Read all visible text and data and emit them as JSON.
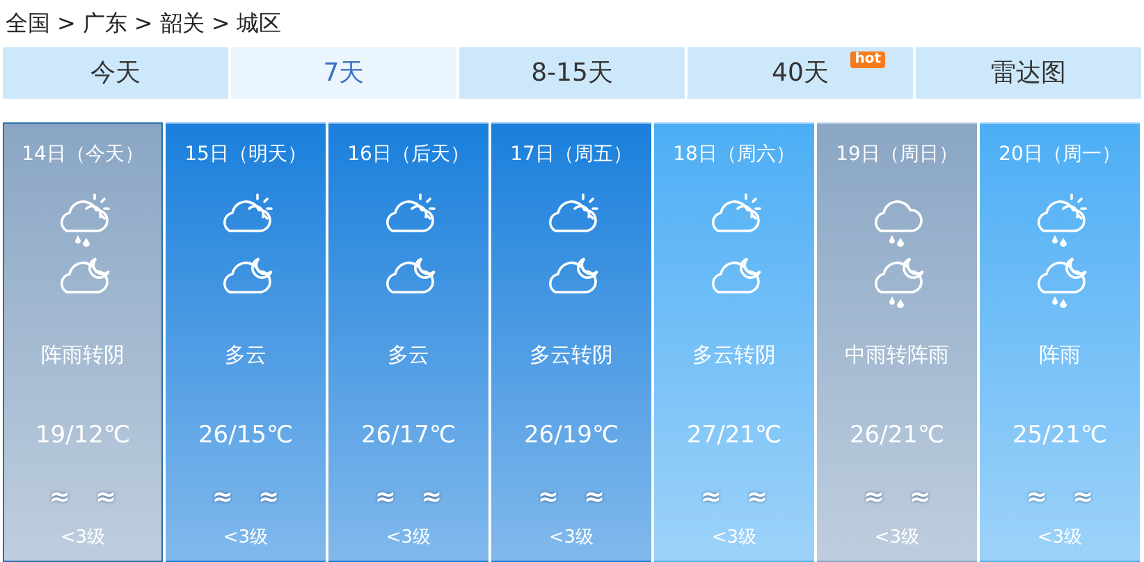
{
  "breadcrumb": [
    "全国",
    ">",
    "广东",
    ">",
    "韶关",
    ">",
    "城区"
  ],
  "tabs": [
    {
      "label": "今天",
      "selected": false
    },
    {
      "label": "7天",
      "selected": true
    },
    {
      "label": "8-15天",
      "selected": false
    },
    {
      "label": "40天",
      "selected": false,
      "badge": "hot"
    },
    {
      "label": "雷达图",
      "selected": false
    }
  ],
  "days": [
    {
      "date": "14日（今天）",
      "selected": true,
      "color": "#8aa6c4",
      "day_icon": {
        "kind": "shower"
      },
      "night_icon": {
        "kind": "cloudy-night"
      },
      "weather": "阵雨转阴",
      "temp": "19/12℃",
      "wind": [
        "≈",
        "≈"
      ],
      "level": "<3级"
    },
    {
      "date": "15日（明天）",
      "selected": false,
      "color": "#1a7fdc",
      "day_icon": {
        "kind": "partly-cloudy"
      },
      "night_icon": {
        "kind": "cloudy-night"
      },
      "weather": "多云",
      "temp": "26/15℃",
      "wind": [
        "≈",
        "≈"
      ],
      "level": "<3级"
    },
    {
      "date": "16日（后天）",
      "selected": false,
      "color": "#1a7fdc",
      "day_icon": {
        "kind": "partly-cloudy"
      },
      "night_icon": {
        "kind": "cloudy-night"
      },
      "weather": "多云",
      "temp": "26/17℃",
      "wind": [
        "≈",
        "≈"
      ],
      "level": "<3级"
    },
    {
      "date": "17日（周五）",
      "selected": false,
      "color": "#1a7fdc",
      "day_icon": {
        "kind": "partly-cloudy"
      },
      "night_icon": {
        "kind": "cloudy-night"
      },
      "weather": "多云转阴",
      "temp": "26/19℃",
      "wind": [
        "≈",
        "≈"
      ],
      "level": "<3级"
    },
    {
      "date": "18日（周六）",
      "selected": false,
      "color": "#4daef5",
      "day_icon": {
        "kind": "partly-cloudy"
      },
      "night_icon": {
        "kind": "cloudy-night"
      },
      "weather": "多云转阴",
      "temp": "27/21℃",
      "wind": [
        "≈",
        "≈"
      ],
      "level": "<3级"
    },
    {
      "date": "19日（周日）",
      "selected": false,
      "color": "#8aa6c4",
      "day_icon": {
        "kind": "rain"
      },
      "night_icon": {
        "kind": "shower-night"
      },
      "weather": "中雨转阵雨",
      "temp": "26/21℃",
      "wind": [
        "≈",
        "≈"
      ],
      "level": "<3级"
    },
    {
      "date": "20日（周一）",
      "selected": false,
      "color": "#4daef5",
      "day_icon": {
        "kind": "shower"
      },
      "night_icon": {
        "kind": "shower-night"
      },
      "weather": "阵雨",
      "temp": "25/21℃",
      "wind": [
        "≈",
        "≈"
      ],
      "level": "<3级"
    }
  ]
}
